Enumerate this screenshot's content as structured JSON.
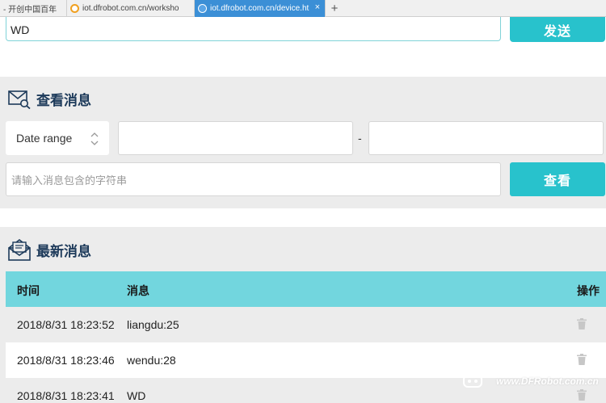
{
  "browser": {
    "tabs": [
      {
        "label": "- 开创中国百年",
        "active": false
      },
      {
        "label": "iot.dfrobot.com.cn/worksho",
        "active": false
      },
      {
        "label": "iot.dfrobot.com.cn/device.ht",
        "active": true
      }
    ],
    "new_tab_symbol": "+",
    "close_symbol": "×"
  },
  "send": {
    "input_value": "WD",
    "button_label": "发送"
  },
  "view": {
    "title": "查看消息",
    "icon": "envelope-search-icon",
    "date_range_label": "Date range",
    "date_separator": "-",
    "search_placeholder": "请输入消息包含的字符串",
    "search_button_label": "查看"
  },
  "latest": {
    "title": "最新消息",
    "icon": "open-envelope-icon",
    "columns": {
      "time": "时间",
      "message": "消息",
      "action": "操作"
    },
    "rows": [
      {
        "time": "2018/8/31 18:23:52",
        "message": "liangdu:25"
      },
      {
        "time": "2018/8/31 18:23:46",
        "message": "wendu:28"
      },
      {
        "time": "2018/8/31 18:23:41",
        "message": "WD"
      }
    ]
  },
  "watermark": {
    "text": "www.DFRobot.com.cn"
  },
  "colors": {
    "accent": "#28c2cc",
    "table_header": "#72d6de",
    "title": "#1d3a5a",
    "panel": "#ececec"
  }
}
